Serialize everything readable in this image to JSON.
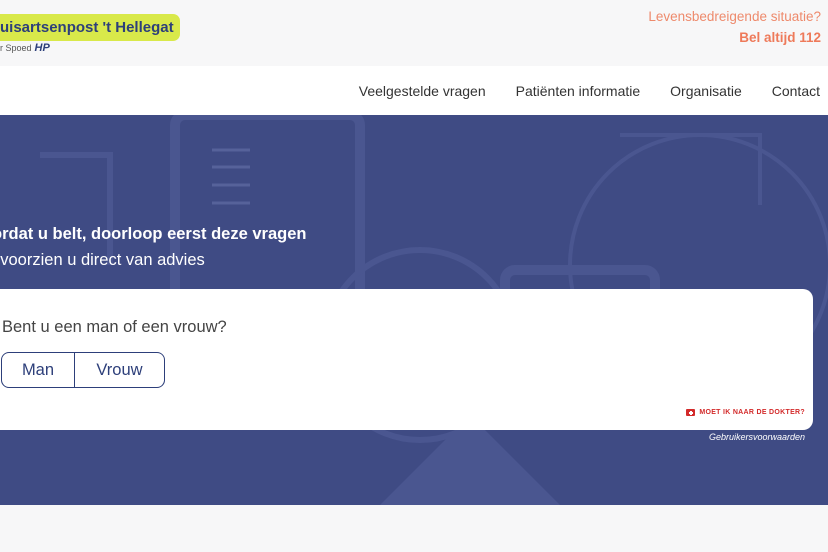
{
  "brand": {
    "logo_text": "uisartsenpost 't Hellegat",
    "tagline": "r Spoed",
    "mark": "HP"
  },
  "emergency": {
    "question": "Levensbedreigende situatie?",
    "call": "Bel altijd 112"
  },
  "nav": {
    "items": [
      "Veelgestelde vragen",
      "Patiënten informatie",
      "Organisatie",
      "Contact"
    ]
  },
  "hero": {
    "title": "ordat u belt, doorloop eerst deze vragen",
    "subtitle": "j voorzien u direct van advies"
  },
  "card": {
    "question": "Bent u een man of een vrouw?",
    "options": [
      "Man",
      "Vrouw"
    ],
    "doctor_link": "MOET IK NAAR DE DOKTER?"
  },
  "footer": {
    "terms": "Gebruikersvoorwaarden"
  },
  "colors": {
    "accent": "#d9e94a",
    "brand_blue": "#2d3f7a",
    "hero_bg": "#3f4b84",
    "emergency": "#ee7a5a",
    "alert_red": "#d32a2a"
  }
}
